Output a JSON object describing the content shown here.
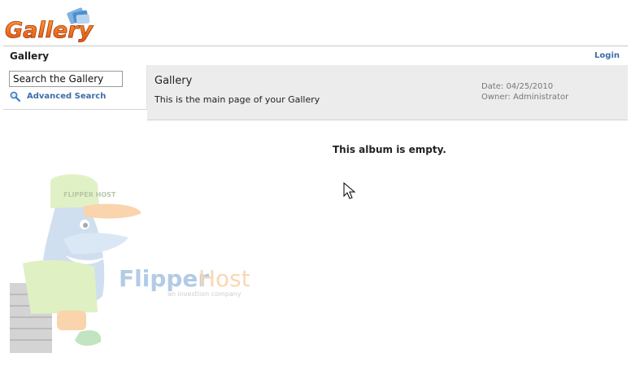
{
  "logo_text": "Gallery",
  "breadcrumb": {
    "current": "Gallery"
  },
  "login_label": "Login",
  "search": {
    "value": "Search the Gallery",
    "advanced_label": "Advanced Search"
  },
  "album": {
    "title": "Gallery",
    "description": "This is the main page of your Gallery",
    "date": "Date: 04/25/2010",
    "owner": "Owner: Administrator",
    "empty_message": "This album is empty."
  },
  "watermark": {
    "cap_text": "FLIPPER HOST",
    "brand_a": "Flipper",
    "brand_b": "Host",
    "tagline": "an investlion company"
  },
  "colors": {
    "link": "#3b6ea8",
    "logo_orange": "#f06a12",
    "panel_bg": "#ececec"
  }
}
